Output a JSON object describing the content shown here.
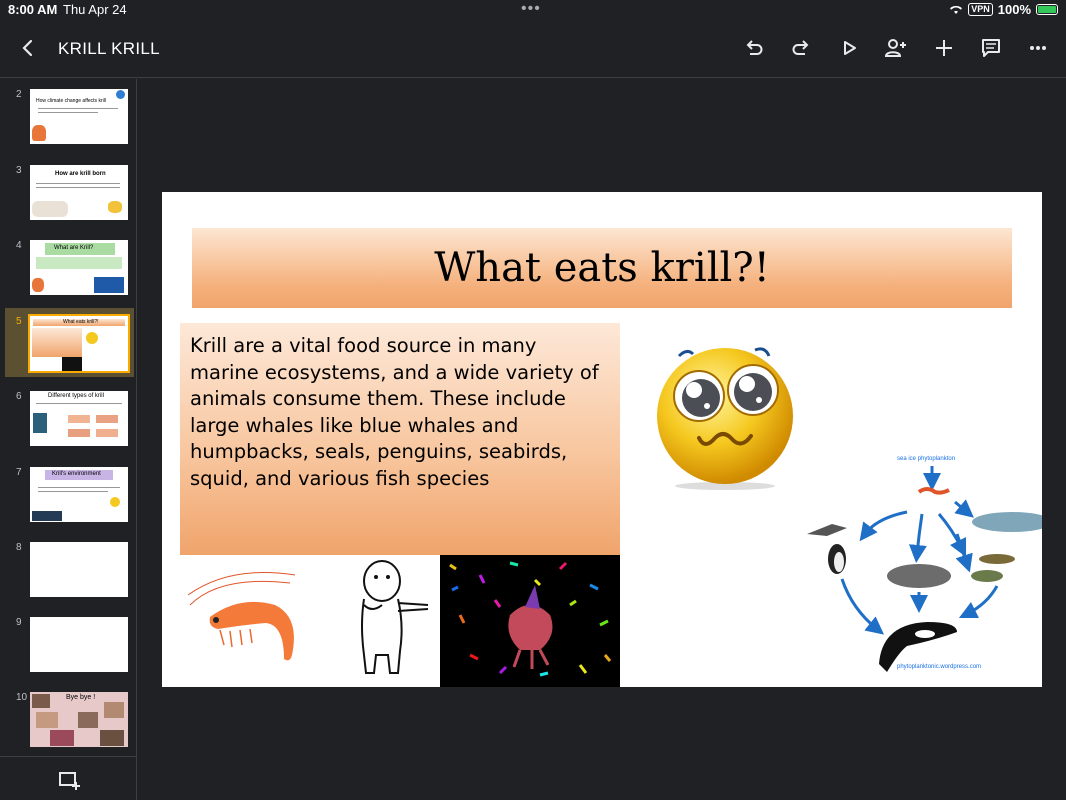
{
  "status": {
    "time": "8:00 AM",
    "date": "Thu Apr 24",
    "vpn": "VPN",
    "battery": "100%"
  },
  "toolbar": {
    "title": "KRILL KRILL",
    "icons": [
      "back-icon",
      "undo-icon",
      "redo-icon",
      "present-icon",
      "share-person-icon",
      "add-icon",
      "comments-icon",
      "more-icon"
    ]
  },
  "sidebar": {
    "slides": [
      {
        "num": "2",
        "title": "How climate change affects krill"
      },
      {
        "num": "3",
        "title": "How are krill born"
      },
      {
        "num": "4",
        "title": "What are Krill?"
      },
      {
        "num": "5",
        "title": "What eats krill?!"
      },
      {
        "num": "6",
        "title": "Different types of krill"
      },
      {
        "num": "7",
        "title": "Krill's environment"
      },
      {
        "num": "8",
        "title": ""
      },
      {
        "num": "9",
        "title": ""
      },
      {
        "num": "10",
        "title": "Bye bye !"
      }
    ],
    "selected": "5"
  },
  "slide": {
    "title": "What eats krill?!",
    "body": "Krill are a vital food source in many marine ecosystems, and a wide variety of animals consume them. These include large whales like blue whales and humpbacks, seals, penguins, seabirds, squid, and various fish species",
    "foodweb_top": "sea ice phytoplankton",
    "foodweb_bottom": "phytoplanktonic.wordpress.com"
  },
  "colors": {
    "accent": "#f9ab00",
    "title_gradient_end": "#f0a46b"
  }
}
